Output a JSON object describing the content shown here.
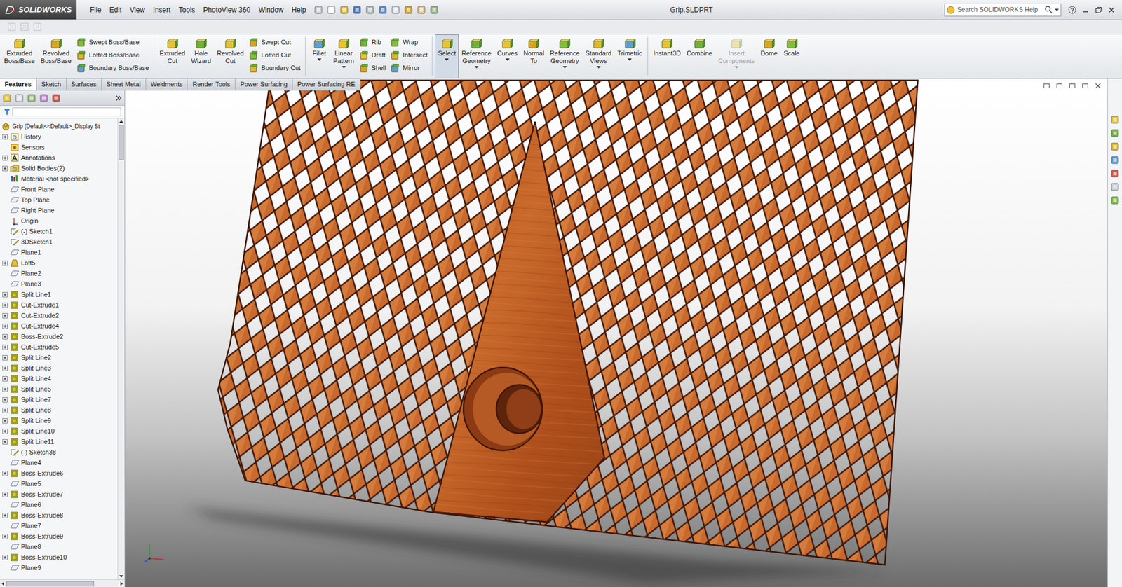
{
  "app": {
    "name": "SOLIDWORKS"
  },
  "window": {
    "title": "Grip.SLDPRT"
  },
  "menu": [
    "File",
    "Edit",
    "View",
    "Insert",
    "Tools",
    "PhotoView 360",
    "Window",
    "Help"
  ],
  "search": {
    "placeholder": "Search SOLIDWORKS Help"
  },
  "ribbon": {
    "groups": [
      {
        "large": [
          {
            "lines": [
              "Extruded",
              "Boss/Base"
            ],
            "selected": false,
            "disabled": false,
            "dropdown": false
          },
          {
            "lines": [
              "Revolved",
              "Boss/Base"
            ],
            "selected": false,
            "disabled": false,
            "dropdown": false
          }
        ],
        "small": [
          [
            {
              "label": "Swept Boss/Base"
            },
            {
              "label": "Lofted Boss/Base"
            },
            {
              "label": "Boundary Boss/Base"
            }
          ]
        ]
      },
      {
        "large": [
          {
            "lines": [
              "Extruded",
              "Cut"
            ],
            "selected": false,
            "disabled": false,
            "dropdown": false
          },
          {
            "lines": [
              "Hole",
              "Wizard"
            ],
            "selected": false,
            "disabled": false,
            "dropdown": false
          },
          {
            "lines": [
              "Revolved",
              "Cut"
            ],
            "selected": false,
            "disabled": false,
            "dropdown": false
          }
        ],
        "small": [
          [
            {
              "label": "Swept Cut"
            },
            {
              "label": "Lofted Cut"
            },
            {
              "label": "Boundary Cut"
            }
          ]
        ]
      },
      {
        "large": [
          {
            "lines": [
              "Fillet"
            ],
            "selected": false,
            "disabled": false,
            "dropdown": true
          },
          {
            "lines": [
              "Linear",
              "Pattern"
            ],
            "selected": false,
            "disabled": false,
            "dropdown": true
          }
        ],
        "small": [
          [
            {
              "label": "Rib"
            },
            {
              "label": "Draft"
            },
            {
              "label": "Shell"
            }
          ],
          [
            {
              "label": "Wrap"
            },
            {
              "label": "Intersect"
            },
            {
              "label": "Mirror"
            }
          ]
        ]
      },
      {
        "large": [
          {
            "lines": [
              "Select"
            ],
            "selected": true,
            "disabled": false,
            "dropdown": true
          },
          {
            "lines": [
              "Reference",
              "Geometry"
            ],
            "selected": false,
            "disabled": false,
            "dropdown": true
          },
          {
            "lines": [
              "Curves"
            ],
            "selected": false,
            "disabled": false,
            "dropdown": true
          },
          {
            "lines": [
              "Normal",
              "To"
            ],
            "selected": false,
            "disabled": false,
            "dropdown": false
          },
          {
            "lines": [
              "Reference",
              "Geometry"
            ],
            "selected": false,
            "disabled": false,
            "dropdown": true
          },
          {
            "lines": [
              "Standard",
              "Views"
            ],
            "selected": false,
            "disabled": false,
            "dropdown": true
          },
          {
            "lines": [
              "Trimetric"
            ],
            "selected": false,
            "disabled": false,
            "dropdown": true
          }
        ],
        "small": []
      },
      {
        "large": [
          {
            "lines": [
              "Instant3D"
            ],
            "selected": false,
            "disabled": false,
            "dropdown": false
          },
          {
            "lines": [
              "Combine"
            ],
            "selected": false,
            "disabled": false,
            "dropdown": false
          },
          {
            "lines": [
              "Insert",
              "Components"
            ],
            "selected": false,
            "disabled": true,
            "dropdown": true
          },
          {
            "lines": [
              "Dome"
            ],
            "selected": false,
            "disabled": false,
            "dropdown": false
          },
          {
            "lines": [
              "Scale"
            ],
            "selected": false,
            "disabled": false,
            "dropdown": false
          }
        ],
        "small": []
      }
    ]
  },
  "tabs": [
    {
      "label": "Features",
      "selected": true
    },
    {
      "label": "Sketch",
      "selected": false
    },
    {
      "label": "Surfaces",
      "selected": false
    },
    {
      "label": "Sheet Metal",
      "selected": false
    },
    {
      "label": "Weldments",
      "selected": false
    },
    {
      "label": "Render Tools",
      "selected": false
    },
    {
      "label": "Power Surfacing",
      "selected": false
    },
    {
      "label": "Power Surfacing RE",
      "selected": false
    }
  ],
  "tree": {
    "items": [
      {
        "label": "Grip  (Default<<Default>_Display St",
        "kind": "part",
        "expandable": false
      },
      {
        "label": "History",
        "kind": "folder",
        "expandable": true
      },
      {
        "label": "Sensors",
        "kind": "sensor",
        "expandable": false
      },
      {
        "label": "Annotations",
        "kind": "annotation",
        "expandable": true
      },
      {
        "label": "Solid Bodies(2)",
        "kind": "bodies",
        "expandable": true
      },
      {
        "label": "Material <not specified>",
        "kind": "material",
        "expandable": false
      },
      {
        "label": "Front Plane",
        "kind": "plane",
        "expandable": false
      },
      {
        "label": "Top Plane",
        "kind": "plane",
        "expandable": false
      },
      {
        "label": "Right Plane",
        "kind": "plane",
        "expandable": false
      },
      {
        "label": "Origin",
        "kind": "origin",
        "expandable": false
      },
      {
        "label": "(-) Sketch1",
        "kind": "sketch",
        "expandable": false
      },
      {
        "label": "3DSketch1",
        "kind": "sketch",
        "expandable": false
      },
      {
        "label": "Plane1",
        "kind": "plane",
        "expandable": false
      },
      {
        "label": "Loft5",
        "kind": "loft",
        "expandable": true
      },
      {
        "label": "Plane2",
        "kind": "plane",
        "expandable": false
      },
      {
        "label": "Plane3",
        "kind": "plane",
        "expandable": false
      },
      {
        "label": "Split Line1",
        "kind": "feature",
        "expandable": true
      },
      {
        "label": "Cut-Extrude1",
        "kind": "feature",
        "expandable": true
      },
      {
        "label": "Cut-Extrude2",
        "kind": "feature",
        "expandable": true
      },
      {
        "label": "Cut-Extrude4",
        "kind": "feature",
        "expandable": true
      },
      {
        "label": "Boss-Extrude2",
        "kind": "feature",
        "expandable": true
      },
      {
        "label": "Cut-Extrude5",
        "kind": "feature",
        "expandable": true
      },
      {
        "label": "Split Line2",
        "kind": "feature",
        "expandable": true
      },
      {
        "label": "Split Line3",
        "kind": "feature",
        "expandable": true
      },
      {
        "label": "Split Line4",
        "kind": "feature",
        "expandable": true
      },
      {
        "label": "Split Line5",
        "kind": "feature",
        "expandable": true
      },
      {
        "label": "Split Line7",
        "kind": "feature",
        "expandable": true
      },
      {
        "label": "Split Line8",
        "kind": "feature",
        "expandable": true
      },
      {
        "label": "Split Line9",
        "kind": "feature",
        "expandable": true
      },
      {
        "label": "Split Line10",
        "kind": "feature",
        "expandable": true
      },
      {
        "label": "Split Line11",
        "kind": "feature",
        "expandable": true
      },
      {
        "label": "(-) Sketch38",
        "kind": "sketch",
        "expandable": false
      },
      {
        "label": "Plane4",
        "kind": "plane",
        "expandable": false
      },
      {
        "label": "Boss-Extrude6",
        "kind": "feature",
        "expandable": true
      },
      {
        "label": "Plane5",
        "kind": "plane",
        "expandable": false
      },
      {
        "label": "Boss-Extrude7",
        "kind": "feature",
        "expandable": true
      },
      {
        "label": "Plane6",
        "kind": "plane",
        "expandable": false
      },
      {
        "label": "Boss-Extrude8",
        "kind": "feature",
        "expandable": true
      },
      {
        "label": "Plane7",
        "kind": "plane",
        "expandable": false
      },
      {
        "label": "Boss-Extrude9",
        "kind": "feature",
        "expandable": true
      },
      {
        "label": "Plane8",
        "kind": "plane",
        "expandable": false
      },
      {
        "label": "Boss-Extrude10",
        "kind": "feature",
        "expandable": true
      },
      {
        "label": "Plane9",
        "kind": "plane",
        "expandable": false
      }
    ]
  }
}
